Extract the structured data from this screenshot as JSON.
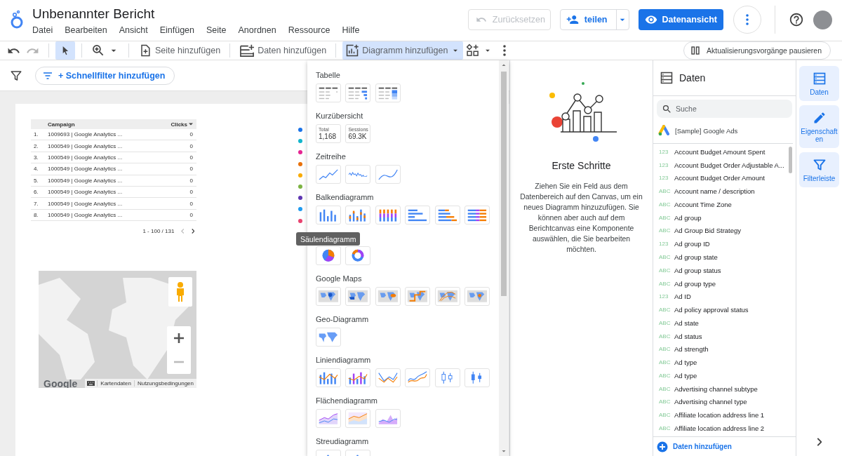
{
  "header": {
    "title": "Unbenannter Bericht",
    "menu": [
      "Datei",
      "Bearbeiten",
      "Ansicht",
      "Einfügen",
      "Seite",
      "Anordnen",
      "Ressource",
      "Hilfe"
    ],
    "reset_button": {
      "label": "Zurücksetzen",
      "disabled": true
    },
    "share_button": {
      "label": "teilen"
    },
    "view_button": {
      "label": "Datenansicht"
    }
  },
  "toolbar": {
    "items": [
      {
        "kind": "undo",
        "selected": false,
        "disabled": false
      },
      {
        "kind": "redo",
        "selected": false,
        "disabled": true
      },
      {
        "kind": "select",
        "selected": true,
        "disabled": false
      },
      {
        "kind": "zoom",
        "selected": false,
        "disabled": false
      },
      {
        "kind": "add_page",
        "label": "Seite hinzufügen",
        "selected": false,
        "disabled": false
      },
      {
        "kind": "add_data",
        "label": "Daten hinzufügen",
        "selected": false,
        "disabled": false
      },
      {
        "kind": "add_chart",
        "label": "Diagramm hinzufügen",
        "selected": true,
        "disabled": false
      },
      {
        "kind": "controls",
        "selected": false,
        "disabled": false
      },
      {
        "kind": "more",
        "selected": false,
        "disabled": false
      }
    ],
    "pause_button": {
      "label": "Aktualisierungsvorgänge pausieren"
    }
  },
  "filter_bar": {
    "quick_filter_button": "+ Schnellfilter hinzufügen"
  },
  "canvas": {
    "table": {
      "columns": [
        "Campaign",
        "Clicks"
      ],
      "rows": [
        {
          "index": "1.",
          "campaign": "1009693 | Google Analytics ...",
          "clicks": "0"
        },
        {
          "index": "2.",
          "campaign": "1000549 | Google Analytics ...",
          "clicks": "0"
        },
        {
          "index": "3.",
          "campaign": "1000549 | Google Analytics ...",
          "clicks": "0"
        },
        {
          "index": "4.",
          "campaign": "1000549 | Google Analytics ...",
          "clicks": "0"
        },
        {
          "index": "5.",
          "campaign": "1000549 | Google Analytics ...",
          "clicks": "0"
        },
        {
          "index": "6.",
          "campaign": "1000549 | Google Analytics ...",
          "clicks": "0"
        },
        {
          "index": "7.",
          "campaign": "1000549 | Google Analytics ...",
          "clicks": "0"
        },
        {
          "index": "8.",
          "campaign": "1000549 | Google Analytics ...",
          "clicks": "0"
        }
      ],
      "pagination": "1 - 100 / 131"
    },
    "legend_dots": [
      {
        "color": "#1a73e8"
      },
      {
        "color": "#12b5cb"
      },
      {
        "color": "#e52592"
      },
      {
        "color": "#e8710a"
      },
      {
        "color": "#f9ab00"
      },
      {
        "color": "#7cb342"
      },
      {
        "color": "#5e35b1"
      },
      {
        "color": "#1e9af0"
      },
      {
        "color": "#e8436f"
      }
    ],
    "map": {
      "logo": "Google",
      "links": [
        "Kartendaten",
        "Nutzungsbedingungen"
      ]
    }
  },
  "chart_menu": {
    "sections": [
      {
        "title": "Tabelle",
        "items": [
          {
            "kind": "table"
          },
          {
            "kind": "table_bars"
          },
          {
            "kind": "table_heatmap"
          }
        ]
      },
      {
        "title": "Kurzübersicht",
        "items": [
          {
            "kind": "scorecard",
            "label": "Total",
            "value": "1,168"
          },
          {
            "kind": "scorecard",
            "label": "Sessions",
            "value": "69.3K"
          }
        ]
      },
      {
        "title": "Zeitreihe",
        "items": [
          {
            "kind": "line"
          },
          {
            "kind": "line_sparse"
          },
          {
            "kind": "line_smooth"
          }
        ]
      },
      {
        "title": "Balkendiagramm",
        "items": [
          {
            "kind": "column"
          },
          {
            "kind": "column_grouped"
          },
          {
            "kind": "column_stacked"
          },
          {
            "kind": "bar"
          },
          {
            "kind": "bar_grouped"
          },
          {
            "kind": "bar_stacked"
          }
        ]
      },
      {
        "items": [
          {
            "kind": "pie"
          },
          {
            "kind": "donut"
          }
        ]
      },
      {
        "title": "Google Maps",
        "items": [
          {
            "kind": "map"
          },
          {
            "kind": "map_filled"
          },
          {
            "kind": "map_heat"
          },
          {
            "kind": "map_lines"
          },
          {
            "kind": "map_connections"
          },
          {
            "kind": "map_mixed"
          }
        ]
      },
      {
        "title": "Geo-Diagramm",
        "items": [
          {
            "kind": "geo"
          }
        ]
      },
      {
        "title": "Liniendiagramm",
        "items": [
          {
            "kind": "combo"
          },
          {
            "kind": "combo_grouped"
          },
          {
            "kind": "line_dual"
          },
          {
            "kind": "line_smooth_dual"
          },
          {
            "kind": "candlestick"
          },
          {
            "kind": "candlestick_filled"
          }
        ]
      },
      {
        "title": "Flächendiagramm",
        "items": [
          {
            "kind": "area"
          },
          {
            "kind": "area_stacked"
          },
          {
            "kind": "area_overlap"
          }
        ]
      },
      {
        "title": "Streudiagramm",
        "items": [
          {
            "kind": "scatter"
          },
          {
            "kind": "scatter"
          }
        ]
      }
    ]
  },
  "tooltip": "Säulendiagramm",
  "getting_started": {
    "title": "Erste Schritte",
    "text": "Ziehen Sie ein Feld aus dem Datenbereich auf den Canvas, um ein neues Diagramm hinzuzufügen. Sie können aber auch auf dem Berichtcanvas eine Komponente auswählen, die Sie bearbeiten möchten."
  },
  "data_panel": {
    "title": "Daten",
    "search": {
      "placeholder": "Suche"
    },
    "source": "[Sample] Google Ads",
    "fields": [
      {
        "type": "123",
        "name": "Account Budget Amount Spent"
      },
      {
        "type": "123",
        "name": "Account Budget Order Adjustable A..."
      },
      {
        "type": "123",
        "name": "Account Budget Order Amount"
      },
      {
        "type": "ABC",
        "name": "Account name / description"
      },
      {
        "type": "ABC",
        "name": "Account Time Zone"
      },
      {
        "type": "ABC",
        "name": "Ad group"
      },
      {
        "type": "ABC",
        "name": "Ad Group Bid Strategy"
      },
      {
        "type": "123",
        "name": "Ad group ID"
      },
      {
        "type": "ABC",
        "name": "Ad group state"
      },
      {
        "type": "ABC",
        "name": "Ad group status"
      },
      {
        "type": "ABC",
        "name": "Ad group type"
      },
      {
        "type": "123",
        "name": "Ad ID"
      },
      {
        "type": "ABC",
        "name": "Ad policy approval status"
      },
      {
        "type": "ABC",
        "name": "Ad state"
      },
      {
        "type": "ABC",
        "name": "Ad status"
      },
      {
        "type": "ABC",
        "name": "Ad strength"
      },
      {
        "type": "ABC",
        "name": "Ad type"
      },
      {
        "type": "ABC",
        "name": "Ad type"
      },
      {
        "type": "ABC",
        "name": "Advertising channel subtype"
      },
      {
        "type": "ABC",
        "name": "Advertising channel type"
      },
      {
        "type": "ABC",
        "name": "Affiliate location address line 1"
      },
      {
        "type": "ABC",
        "name": "Affiliate location address line 2"
      }
    ],
    "add_data": "Daten hinzufügen"
  },
  "rail": [
    {
      "kind": "data",
      "label": "Daten"
    },
    {
      "kind": "properties",
      "label": "Eigenschaften"
    },
    {
      "kind": "filter",
      "label": "Filterleiste"
    }
  ]
}
